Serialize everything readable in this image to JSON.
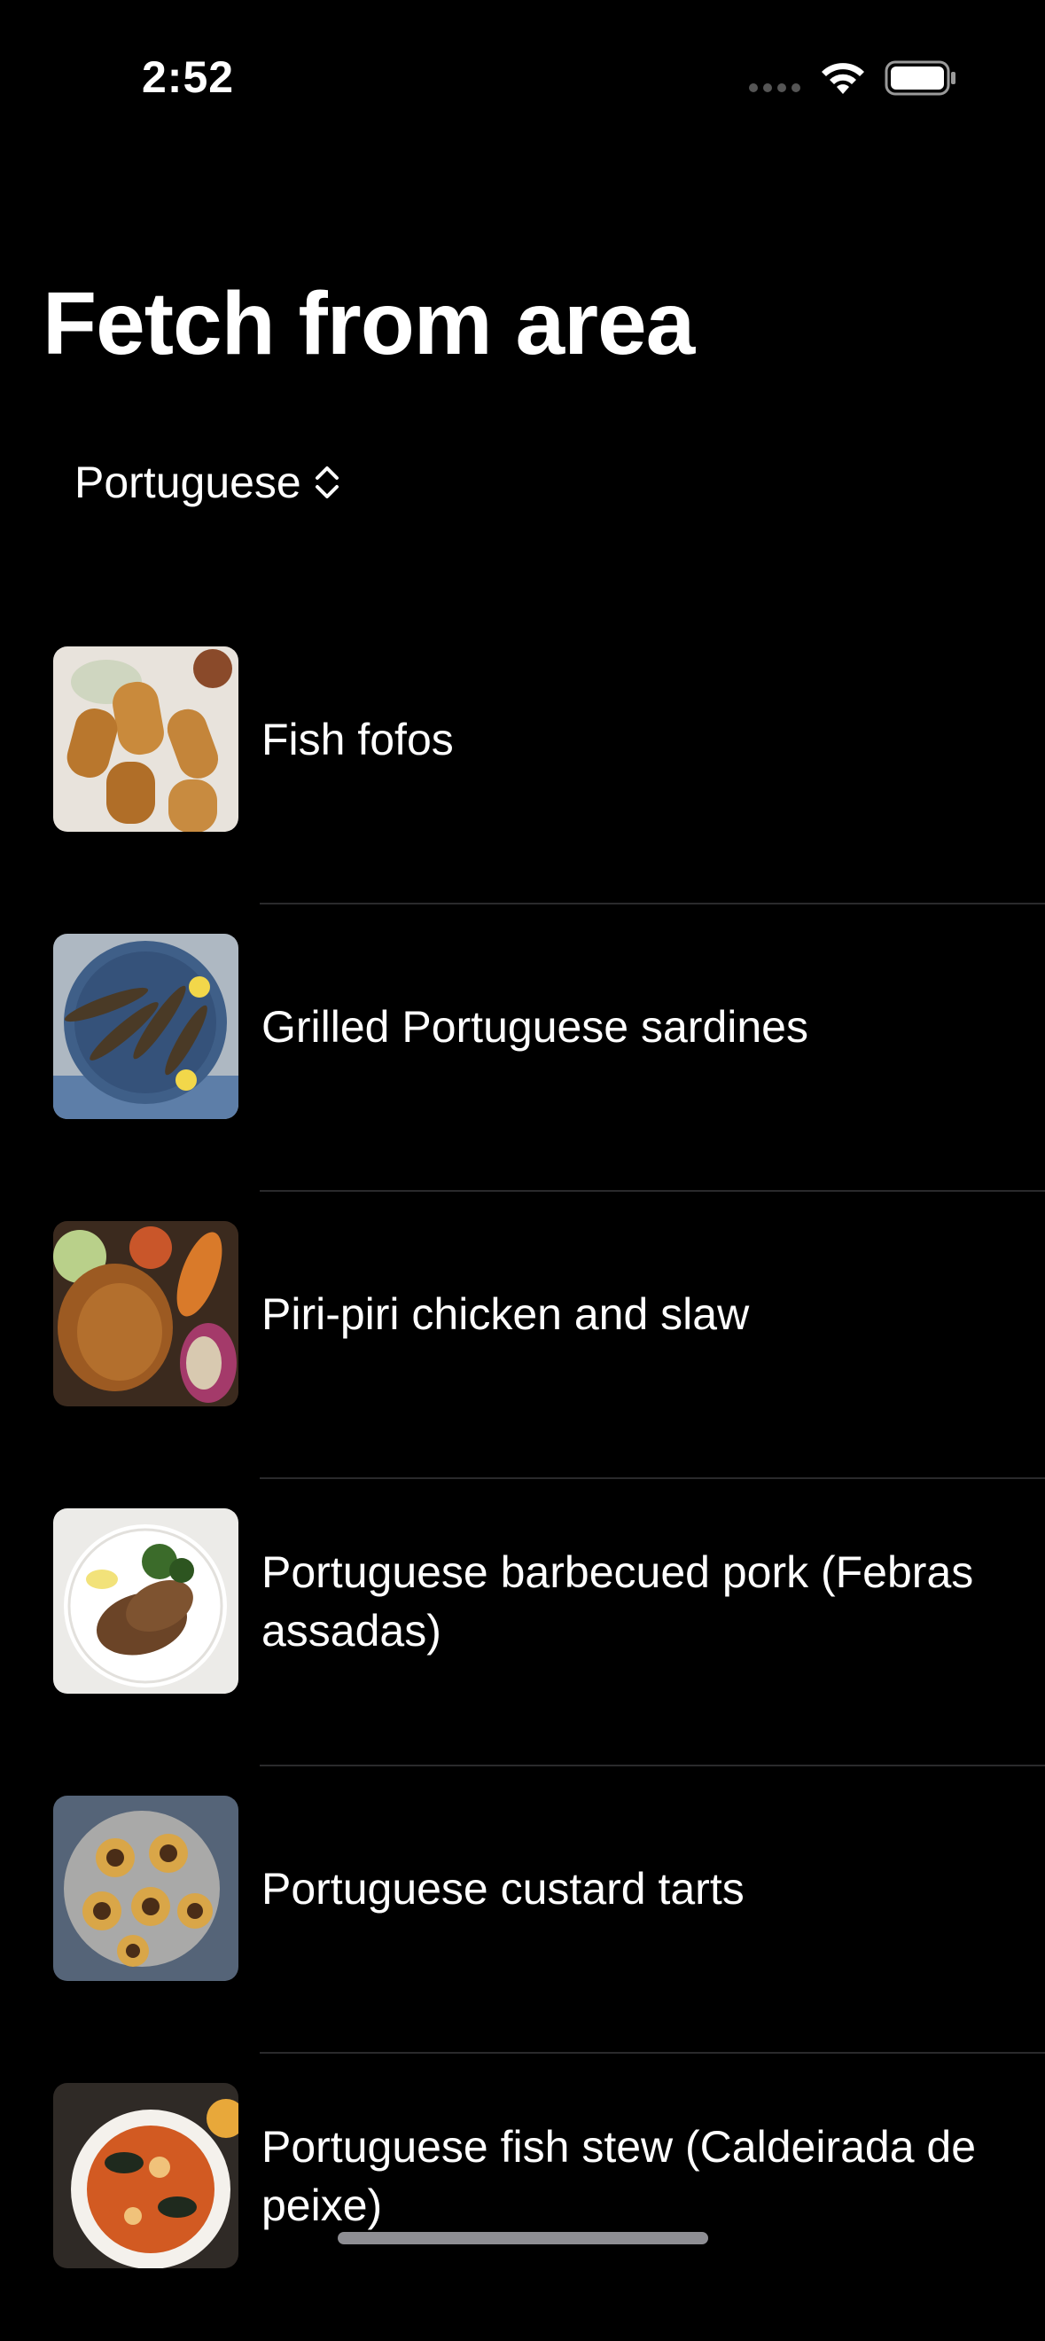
{
  "status_bar": {
    "time": "2:52"
  },
  "page": {
    "title": "Fetch from area"
  },
  "area_picker": {
    "selected": "Portuguese"
  },
  "meals": [
    {
      "name": "Fish fofos",
      "image": "fish-fofos-photo"
    },
    {
      "name": "Grilled Portuguese sardines",
      "image": "grilled-sardines-photo"
    },
    {
      "name": "Piri-piri chicken and slaw",
      "image": "piri-piri-chicken-photo"
    },
    {
      "name": "Portuguese barbecued pork (Febras assadas)",
      "image": "barbecued-pork-photo"
    },
    {
      "name": "Portuguese custard tarts",
      "image": "custard-tarts-photo"
    },
    {
      "name": "Portuguese fish stew (Caldeirada de peixe)",
      "image": "fish-stew-photo"
    }
  ]
}
